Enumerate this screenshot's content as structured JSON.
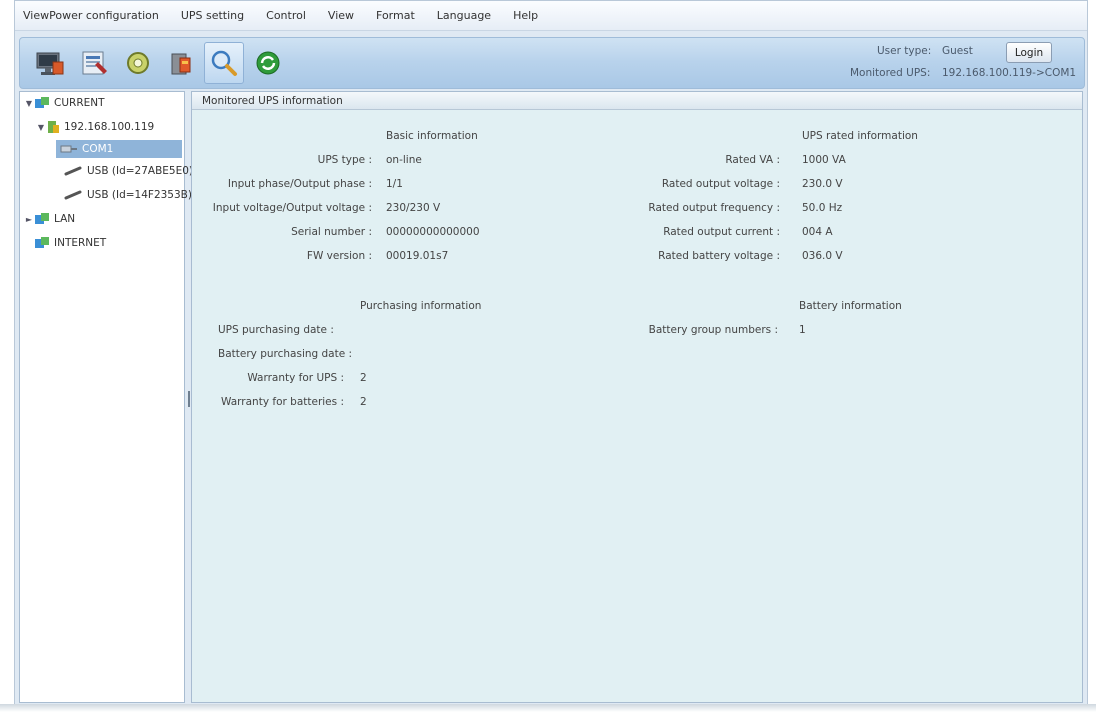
{
  "menu": [
    "ViewPower configuration",
    "UPS setting",
    "Control",
    "View",
    "Format",
    "Language",
    "Help"
  ],
  "toolbar": {
    "buttons": [
      "monitor-icon",
      "configuration-icon",
      "control-icon",
      "shutdown-icon",
      "search-icon",
      "refresh-icon"
    ],
    "user_type_label": "User type:",
    "user_type_value": "Guest",
    "login_label": "Login",
    "monitored_ups_label": "Monitored UPS:",
    "monitored_ups_value": "192.168.100.119->COM1"
  },
  "tree": {
    "current": "CURRENT",
    "host": "192.168.100.119",
    "com": "COM1",
    "usb1": "USB (Id=27ABE5E0)",
    "usb2": "USB (Id=14F2353B)",
    "lan": "LAN",
    "internet": "INTERNET"
  },
  "panel": {
    "title": "Monitored UPS information",
    "basic": {
      "title": "Basic information",
      "rows": [
        {
          "label": "UPS type :",
          "value": "on-line"
        },
        {
          "label": "Input phase/Output phase :",
          "value": "1/1"
        },
        {
          "label": "Input voltage/Output voltage :",
          "value": "230/230 V"
        },
        {
          "label": "Serial number :",
          "value": "00000000000000"
        },
        {
          "label": "FW version :",
          "value": "00019.01s7"
        }
      ]
    },
    "rated": {
      "title": "UPS rated information",
      "rows": [
        {
          "label": "Rated VA :",
          "value": "1000 VA"
        },
        {
          "label": "Rated output voltage :",
          "value": "230.0 V"
        },
        {
          "label": "Rated output frequency :",
          "value": "50.0 Hz"
        },
        {
          "label": "Rated output current :",
          "value": "004 A"
        },
        {
          "label": "Rated battery voltage :",
          "value": "036.0 V"
        }
      ]
    },
    "purchasing": {
      "title": "Purchasing information",
      "rows": [
        {
          "label": "UPS purchasing date :",
          "value": ""
        },
        {
          "label": "Battery purchasing date :",
          "value": ""
        },
        {
          "label": "Warranty for UPS :",
          "value": "2"
        },
        {
          "label": "Warranty for batteries :",
          "value": "2"
        }
      ]
    },
    "battery": {
      "title": "Battery information",
      "rows": [
        {
          "label": "Battery group numbers :",
          "value": "1"
        }
      ]
    }
  }
}
